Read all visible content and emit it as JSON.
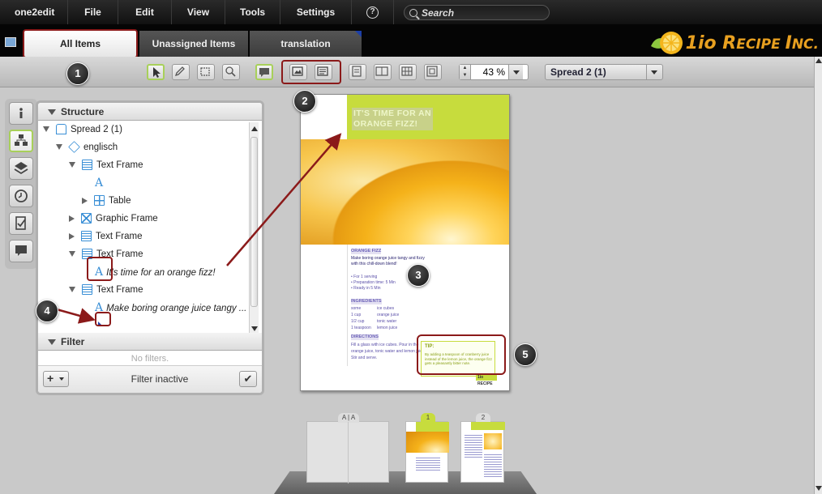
{
  "menubar": {
    "app_label": "one2edit",
    "items": [
      "File",
      "Edit",
      "View",
      "Tools",
      "Settings"
    ],
    "help_label": "?",
    "search_placeholder": "Search"
  },
  "logo": {
    "prefix": "1io ",
    "name_big_r": "R",
    "name_rest": "ECIPE ",
    "name_big_i": "I",
    "name_suffix": "NC."
  },
  "tabs": [
    "All Items",
    "Unassigned Items",
    "translation"
  ],
  "toolbar": {
    "zoom_value": "43 %",
    "spread_label": "Spread 2 (1)"
  },
  "structure": {
    "title": "Structure",
    "tree": [
      {
        "label": "Spread 2 (1)"
      },
      {
        "label": "englisch"
      },
      {
        "label": "Text Frame"
      },
      {
        "label": "A"
      },
      {
        "label": "Table"
      },
      {
        "label": "Graphic Frame"
      },
      {
        "label": "Text Frame"
      },
      {
        "label": "Text Frame"
      },
      {
        "label": "It's time for an  orange fizz!"
      },
      {
        "label": "Text Frame"
      },
      {
        "label": "Make boring orange juice tangy ..."
      }
    ]
  },
  "filter": {
    "title": "Filter",
    "empty": "No filters.",
    "status": "Filter inactive",
    "add_label": "+"
  },
  "page": {
    "headline": "IT'S TIME FOR AN ORANGE FIZZ!",
    "section1_title": "ORANGE FIZZ",
    "intro_lines": [
      "Make boring orange juice tangy and fizzy",
      "with this chill-down blend!"
    ],
    "bullets": [
      "For 1 serving",
      "Preparation time: 5 Min",
      "Ready in 5 Min"
    ],
    "ingredients_title": "INGREDIENTS",
    "ingredients": [
      [
        "some",
        "ice cubes"
      ],
      [
        "1 cup",
        "orange juice"
      ],
      [
        "1/2 cup",
        "tonic water"
      ],
      [
        "1 teaspoon",
        "lemon juice"
      ]
    ],
    "directions_title": "DIRECTIONS",
    "directions": [
      "Fill a glass with ice cubes. Pour in the",
      "orange juice, tonic water and lemon juice.",
      "Stir and serve."
    ],
    "tip_title": "TIP:",
    "tip_text": "By adding a teaspoon of cranberry juice instead of the lemon juice, the orange fizz gets a pleasantly bitter note.",
    "page_logo": "1io RECIPE"
  },
  "thumbnails": {
    "master_label": "A | A",
    "page1_label": "1",
    "page2_label": "2"
  },
  "callouts": [
    "1",
    "2",
    "3",
    "4",
    "5"
  ],
  "icons": [
    "search-icon",
    "help-icon",
    "select-tool-icon",
    "pencil-tool-icon",
    "frame-tool-icon",
    "zoom-tool-icon",
    "comment-icon",
    "image-frame-icon",
    "text-frame-icon",
    "info-icon",
    "structure-icon",
    "layers-icon",
    "history-icon",
    "tasks-icon",
    "comments-icon"
  ],
  "colors": {
    "accent_red": "#8b1a1a",
    "lime": "#c7dc3d",
    "orange": "#e8a020",
    "tree_blue": "#3a8fd6"
  }
}
